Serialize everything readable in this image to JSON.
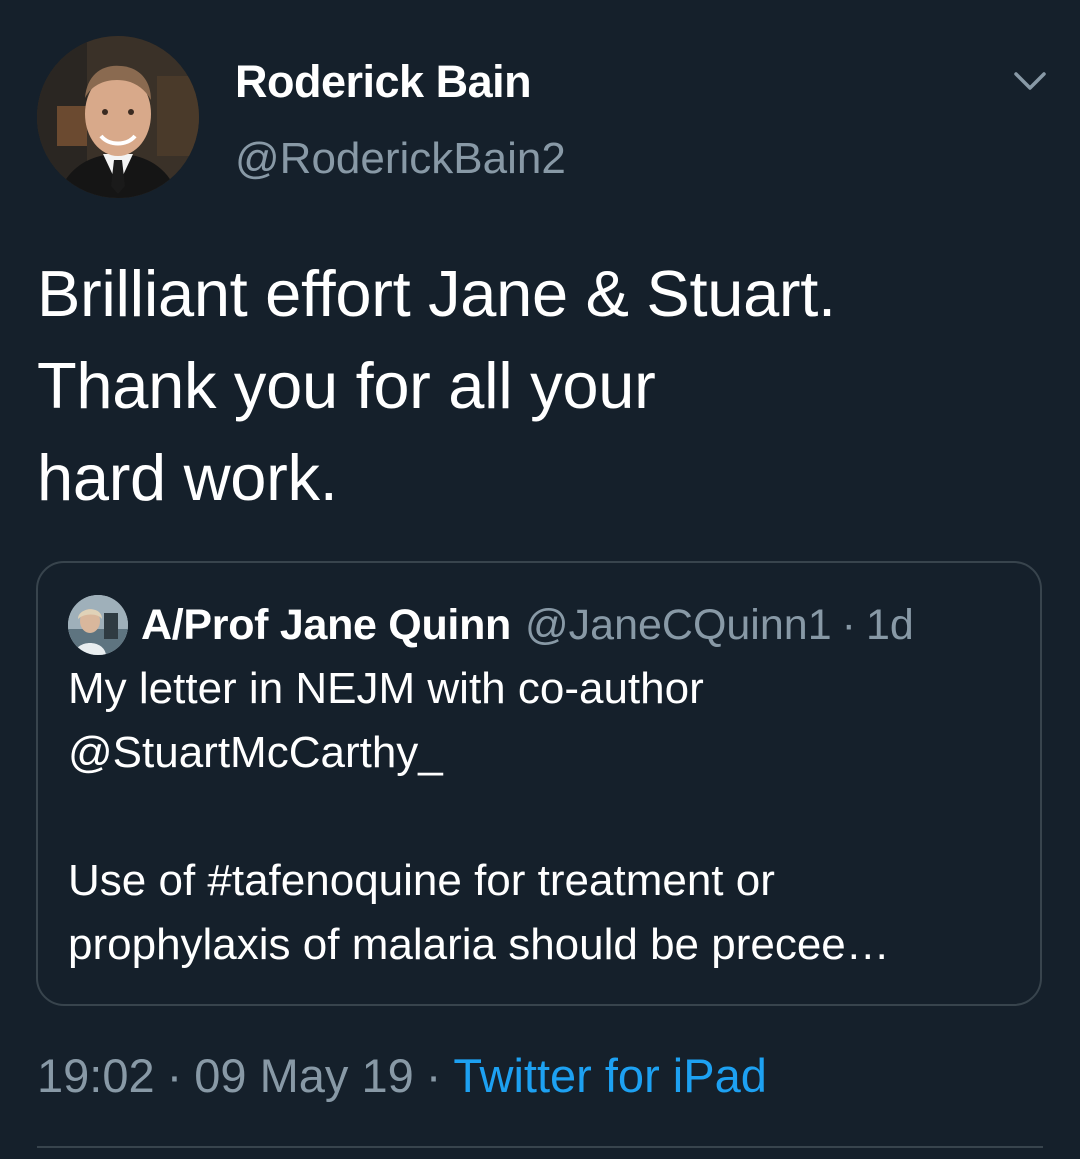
{
  "author": {
    "display_name": "Roderick Bain",
    "handle": "@RoderickBain2"
  },
  "icons": {
    "avatar": "avatar-photo",
    "more": "chevron-down-icon",
    "quoted_avatar": "avatar-photo"
  },
  "tweet": {
    "lines": [
      "Brilliant effort Jane & Stuart.",
      "Thank you for all your",
      "hard work."
    ]
  },
  "quoted_tweet": {
    "display_name": "A/Prof Jane Quinn",
    "handle": "@JaneCQuinn1",
    "separator": "·",
    "age": "1d",
    "lines": [
      "My letter in NEJM with co-author",
      "@StuartMcCarthy_",
      "",
      "Use of #tafenoquine for treatment or",
      "prophylaxis of malaria should be precee…"
    ]
  },
  "meta": {
    "time": "19:02",
    "separator": "·",
    "date": "09 May 19",
    "source": "Twitter for iPad"
  },
  "colors": {
    "background": "#15202b",
    "text": "#ffffff",
    "muted": "#8899a6",
    "link": "#1da1f2",
    "border": "#38444d"
  }
}
